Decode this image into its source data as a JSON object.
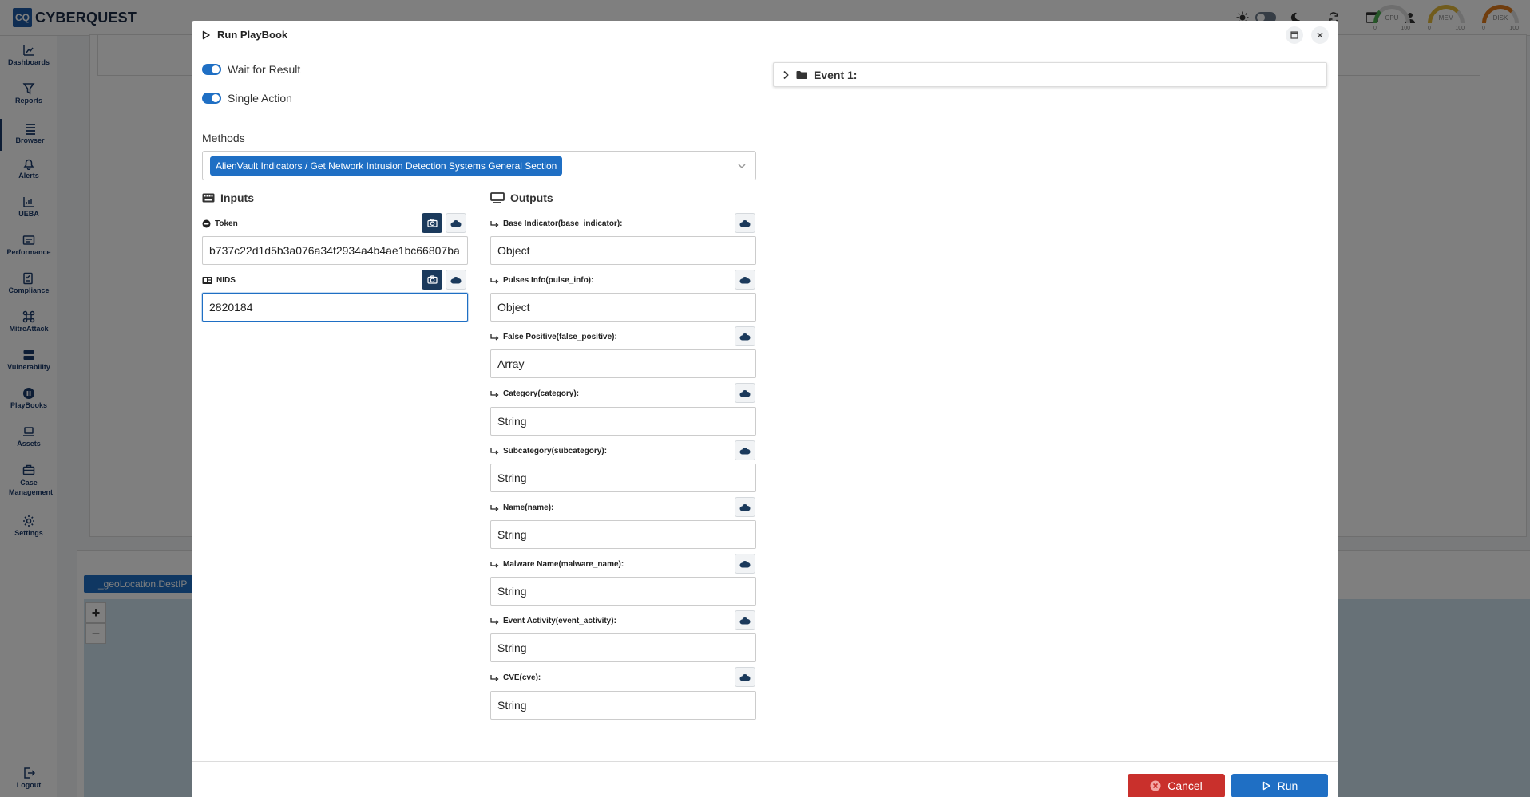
{
  "app": {
    "logo_mark": "CQ",
    "logo_text": "CYBERQUEST",
    "gauges": [
      {
        "label": "CPU",
        "min": "0",
        "max": "100",
        "color": "#4caf50"
      },
      {
        "label": "MEM",
        "min": "0",
        "max": "100",
        "color": "#e2b93b"
      },
      {
        "label": "DISK",
        "min": "0",
        "max": "100",
        "color": "#e07b1a"
      }
    ]
  },
  "sidebar": {
    "items": [
      {
        "label": "Dashboards",
        "icon": "chart-icon"
      },
      {
        "label": "Reports",
        "icon": "filter-icon"
      },
      {
        "label": "Browser",
        "icon": "list-icon"
      },
      {
        "label": "Alerts",
        "icon": "bell-icon"
      },
      {
        "label": "UEBA",
        "icon": "trend-icon"
      },
      {
        "label": "Performance",
        "icon": "gauge-icon"
      },
      {
        "label": "Compliance",
        "icon": "checklist-icon"
      },
      {
        "label": "MitreAttack",
        "icon": "command-icon"
      },
      {
        "label": "Vulnerability",
        "icon": "server-icon"
      },
      {
        "label": "PlayBooks",
        "icon": "play-circle-icon"
      },
      {
        "label": "Assets",
        "icon": "laptop-icon"
      },
      {
        "label": "Case Management",
        "icon": "briefcase-icon"
      },
      {
        "label": "Settings",
        "icon": "gear-icon"
      }
    ],
    "logout_label": "Logout"
  },
  "background": {
    "map_filter_chip": "_geoLocation.DestIP",
    "zoom_in": "+",
    "zoom_out": "−"
  },
  "modal": {
    "title": "Run PlayBook",
    "toggles": [
      {
        "label": "Wait for Result",
        "on": true
      },
      {
        "label": "Single Action",
        "on": true
      }
    ],
    "methods_label": "Methods",
    "methods_selected": "AlienVault Indicators / Get Network Intrusion Detection Systems General Section",
    "inputs_title": "Inputs",
    "inputs": [
      {
        "label": "Token",
        "value": "b737c22d1d5b3a076a34f2934a4b4ae1bc66807ba"
      },
      {
        "label": "NIDS",
        "value": "2820184"
      }
    ],
    "outputs_title": "Outputs",
    "outputs": [
      {
        "label": "Base Indicator(base_indicator):",
        "value": "Object"
      },
      {
        "label": "Pulses Info(pulse_info):",
        "value": "Object"
      },
      {
        "label": "False Positive(false_positive):",
        "value": "Array"
      },
      {
        "label": "Category(category):",
        "value": "String"
      },
      {
        "label": "Subcategory(subcategory):",
        "value": "String"
      },
      {
        "label": "Name(name):",
        "value": "String"
      },
      {
        "label": "Malware Name(malware_name):",
        "value": "String"
      },
      {
        "label": "Event Activity(event_activity):",
        "value": "String"
      },
      {
        "label": "CVE(cve):",
        "value": "String"
      }
    ],
    "event_label": "Event 1:",
    "cancel_label": "Cancel",
    "run_label": "Run"
  }
}
